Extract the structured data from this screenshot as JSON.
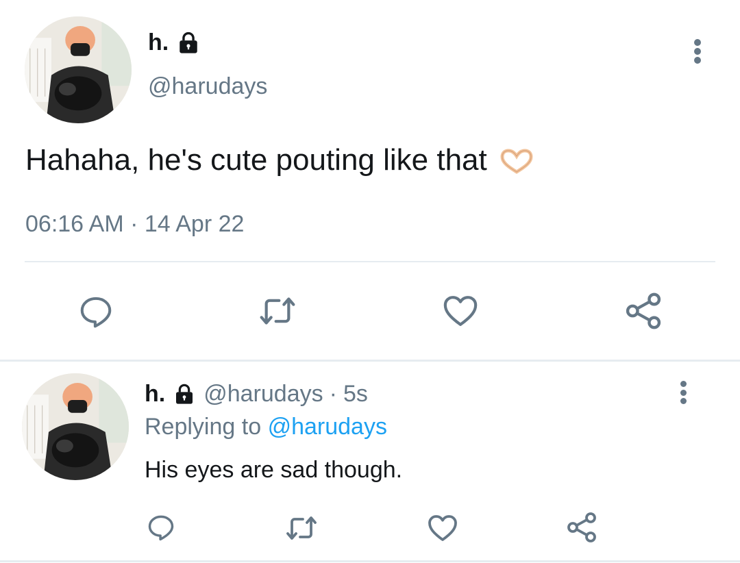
{
  "main_tweet": {
    "display_name": "h.",
    "handle": "@harudays",
    "text": "Hahaha, he's cute pouting like that",
    "emoji": "🫶",
    "timestamp": "06:16 AM · 14 Apr 22",
    "lock_icon": "lock-icon",
    "more_icon": "more-vertical-icon"
  },
  "reply_tweet": {
    "display_name": "h.",
    "handle": "@harudays",
    "time_sep": "·",
    "time": "5s",
    "replying_label": "Replying to",
    "replying_to": "@harudays",
    "text": "His eyes are sad though.",
    "lock_icon": "lock-icon",
    "more_icon": "more-vertical-icon"
  },
  "actions": [
    "reply-icon",
    "retweet-icon",
    "like-icon",
    "share-icon"
  ],
  "colors": {
    "text": "#14171a",
    "secondary": "#657786",
    "link": "#1da1f2",
    "divider": "#e6ecf0"
  }
}
